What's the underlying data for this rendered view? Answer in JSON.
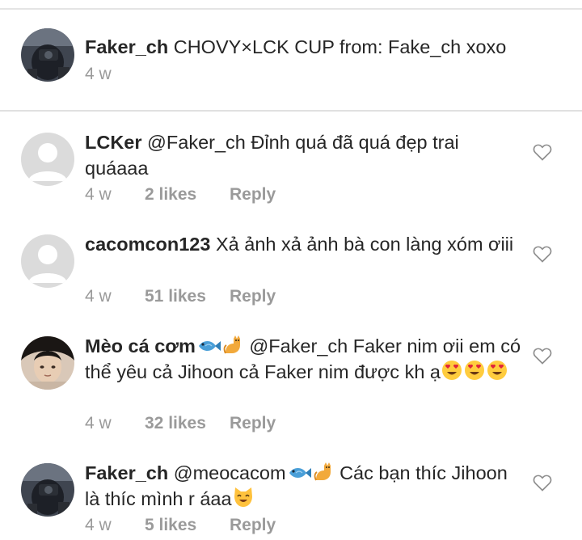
{
  "caption": {
    "username": "Faker_ch",
    "text": "CHOVY×LCK CUP from: Fake_ch xoxo",
    "time": "4 w"
  },
  "comments": [
    {
      "username": "LCKer",
      "text_1": "@Faker_ch Đỉnh quá đã quá đẹp trai quáaaa",
      "time": "4 w",
      "likes": "2 likes",
      "reply": "Reply",
      "avatar_icon": "default-avatar-icon"
    },
    {
      "username": "cacomcon123",
      "text_1": "Xả ảnh xả ảnh bà con làng xóm ơiii",
      "time": "4 w",
      "likes": "51 likes",
      "reply": "Reply",
      "avatar_icon": "default-avatar-icon"
    },
    {
      "username": "Mèo cá cơm",
      "username_emojis": [
        "fish-emoji-icon",
        "cat-emoji-icon"
      ],
      "text_1": "@Faker_ch Faker nim ơii em có thể yêu cả Jihoon cả Faker nim được kh ạ",
      "text_emojis": [
        "heart-eyes-emoji-icon",
        "heart-eyes-emoji-icon",
        "heart-eyes-emoji-icon"
      ],
      "time": "4 w",
      "likes": "32 likes",
      "reply": "Reply",
      "avatar_icon": "photo-avatar-icon"
    },
    {
      "username": "Faker_ch",
      "text_1": "@meocacom",
      "mention_emojis": [
        "fish-emoji-icon",
        "cat-emoji-icon"
      ],
      "text_2": "Các bạn thíc Jihoon là thíc mình r áaa",
      "text_emojis": [
        "smiling-cat-emoji-icon"
      ],
      "time": "4 w",
      "likes": "5 likes",
      "reply": "Reply",
      "avatar_icon": "photo-avatar-icon"
    }
  ],
  "colors": {
    "text": "#262626",
    "meta": "#9a9a9a",
    "divider": "#e0e0e0",
    "avatar_placeholder": "#dbdbdb",
    "heart_outline": "#8e8e8e"
  }
}
